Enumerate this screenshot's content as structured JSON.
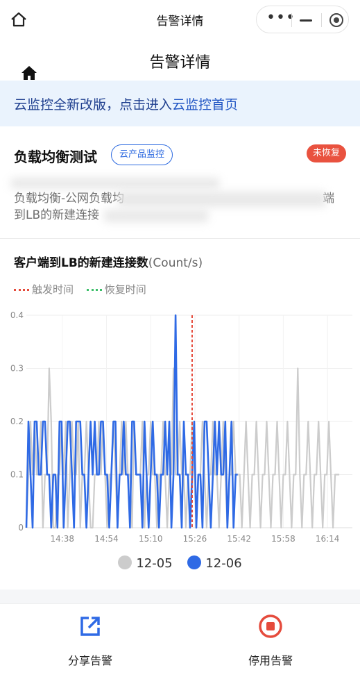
{
  "nav": {
    "title": "告警详情"
  },
  "page": {
    "title": "告警详情"
  },
  "banner": {
    "text": "云监控全新改版，点击进入",
    "link": "云监控首页"
  },
  "alarm": {
    "name": "负载均衡测试",
    "tag": "云产品监控",
    "status": "未恢复",
    "desc_line1_start": "负载均衡-公网负载均",
    "desc_line1_end": "端",
    "desc_line2": "到LB的新建连接"
  },
  "chart_section": {
    "title": "客户端到LB的新建连接数",
    "unit": "(Count/s)",
    "legend_trigger": "触发时间",
    "legend_recover": "恢复时间"
  },
  "chart_data": {
    "type": "line",
    "ylim": [
      0,
      0.4
    ],
    "yticks": [
      "0",
      "0.1",
      "0.2",
      "0.3",
      "0.4"
    ],
    "xticks": [
      "14:38",
      "14:54",
      "15:10",
      "15:26",
      "15:42",
      "15:58",
      "16:14"
    ],
    "trigger_time": "15:25",
    "series": [
      {
        "name": "12-05",
        "color": "#cccccc",
        "start": "14:25",
        "step_minutes": 0.75,
        "values": [
          0,
          0.1,
          0.2,
          0.1,
          0.2,
          0.1,
          0.1,
          0.2,
          0,
          0.1,
          0.1,
          0.3,
          0.2,
          0,
          0,
          0.1,
          0.1,
          0.2,
          0.1,
          0.2,
          0,
          0.1,
          0.2,
          0.1,
          0.1,
          0.2,
          0,
          0.1,
          0.1,
          0.2,
          0.1,
          0,
          0,
          0.1,
          0.1,
          0.2,
          0.1,
          0.2,
          0.1,
          0,
          0.1,
          0.1,
          0.2,
          0.1,
          0,
          0.1,
          0.2,
          0.1,
          0.2,
          0.1,
          0.1,
          0,
          0.2,
          0.1,
          0.1,
          0.1,
          0.2,
          0,
          0.1,
          0.1,
          0.2,
          0.1,
          0.1,
          0,
          0.1,
          0.1,
          0.2,
          0.1,
          0,
          0.1,
          0.1,
          0.3,
          0.1,
          0.1,
          0.2,
          0.1,
          0.1,
          0,
          0.1,
          0.1,
          0.2,
          0.1,
          0,
          0.1,
          0.1,
          0.2,
          0.1,
          0,
          0.1,
          0.1,
          0.2,
          0.1,
          0.1,
          0,
          0.1,
          0.2,
          0.1,
          0,
          0.1,
          0.1,
          0.2,
          0.1,
          0.1,
          0.1,
          0,
          0.1,
          0.2,
          0.1,
          0,
          0.1,
          0.1,
          0.2,
          0.1,
          0,
          0.1,
          0.1,
          0.2,
          0.1,
          0,
          0.1,
          0.1,
          0.2,
          0.1,
          0,
          0.1,
          0.1,
          0.2,
          0.1,
          0,
          0.1,
          0.1,
          0.3,
          0.1,
          0,
          0.1,
          0.1,
          0.2,
          0.1,
          0,
          0.1,
          0.1,
          0.2,
          0.1,
          0,
          0.1,
          0.1,
          0.2,
          0.1,
          0,
          0.1,
          0.1,
          0.1
        ]
      },
      {
        "name": "12-06",
        "color": "#2f6ae5",
        "start": "14:25",
        "step_minutes": 0.75,
        "values": [
          0,
          0.2,
          0.1,
          0,
          0.2,
          0.2,
          0.1,
          0.1,
          0.2,
          0.2,
          0.1,
          0.1,
          0,
          0.1,
          0.1,
          0,
          0.2,
          0.2,
          0,
          0.1,
          0.2,
          0.2,
          0.1,
          0,
          0.2,
          0.2,
          0.2,
          0.1,
          0.1,
          0,
          0.1,
          0.2,
          0.1,
          0.2,
          0.1,
          0.1,
          0.2,
          0.2,
          0.1,
          0.1,
          0,
          0.1,
          0.2,
          0.2,
          0,
          0.1,
          0.1,
          0.2,
          0.1,
          0.1,
          0,
          0.2,
          0.2,
          0.1,
          0.1,
          0.1,
          0,
          0.2,
          0.1,
          0,
          0.1,
          0.2,
          0.1,
          0.1,
          0,
          0.1,
          0.1,
          0.2,
          0.1,
          0.2,
          0,
          0.1,
          0.4,
          0.1,
          0.1,
          0,
          0.2,
          0.1,
          0.1,
          0,
          0.1,
          0.2,
          0,
          0.1,
          0.1,
          0,
          0.2,
          0.2,
          0.1,
          0,
          0.1,
          0.2,
          0.1,
          0.2,
          0.1,
          0.1,
          0.2,
          0,
          0.1,
          0.2,
          0,
          0.1,
          0.1
        ]
      }
    ]
  },
  "actions": {
    "share": "分享告警",
    "stop": "停用告警"
  },
  "icons": {
    "home": "home-icon",
    "more": "more-dots-icon",
    "minimize": "minimize-icon",
    "close": "record-close-icon",
    "share": "share-icon",
    "stop": "stop-icon"
  }
}
